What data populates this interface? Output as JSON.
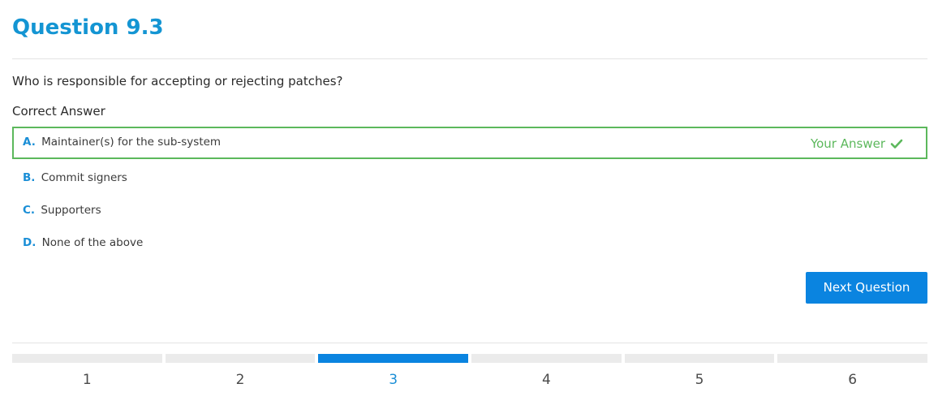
{
  "question": {
    "title": "Question 9.3",
    "text": "Who is responsible for accepting or rejecting patches?",
    "correct_label": "Correct Answer"
  },
  "answers": [
    {
      "letter": "A.",
      "text": "Maintainer(s) for the sub-system",
      "selected": true
    },
    {
      "letter": "B.",
      "text": "Commit signers",
      "selected": false
    },
    {
      "letter": "C.",
      "text": "Supporters",
      "selected": false
    },
    {
      "letter": "D.",
      "text": "None of the above",
      "selected": false
    }
  ],
  "your_answer_label": "Your Answer",
  "next_button_label": "Next Question",
  "progress": {
    "steps": [
      "1",
      "2",
      "3",
      "4",
      "5",
      "6"
    ],
    "current": "3"
  },
  "colors": {
    "title": "#1495d3",
    "correct_border": "#5cb85c",
    "primary": "#0a84e0",
    "inactive_bar": "#ebebeb"
  }
}
